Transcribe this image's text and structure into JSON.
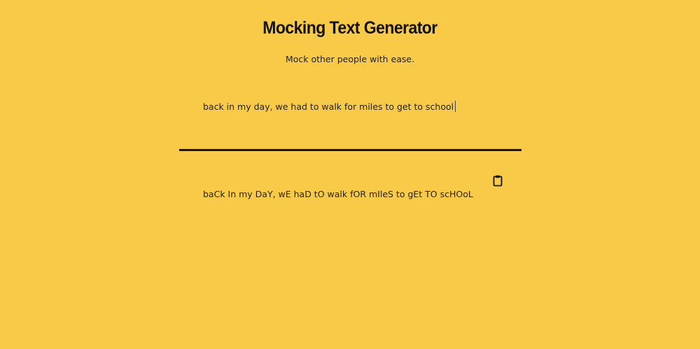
{
  "header": {
    "title": "Mocking Text Generator",
    "subtitle": "Mock other people with ease."
  },
  "input": {
    "value": "back in my day, we had to walk for miles to get to school"
  },
  "output": {
    "text": "baCk In my DaY, wE haD tO walk fOR mIleS to gEt TO scHOoL",
    "copy_icon": "clipboard-icon"
  },
  "colors": {
    "background": "#f9ca48",
    "text": "#1a1a1a",
    "divider": "#111111"
  }
}
